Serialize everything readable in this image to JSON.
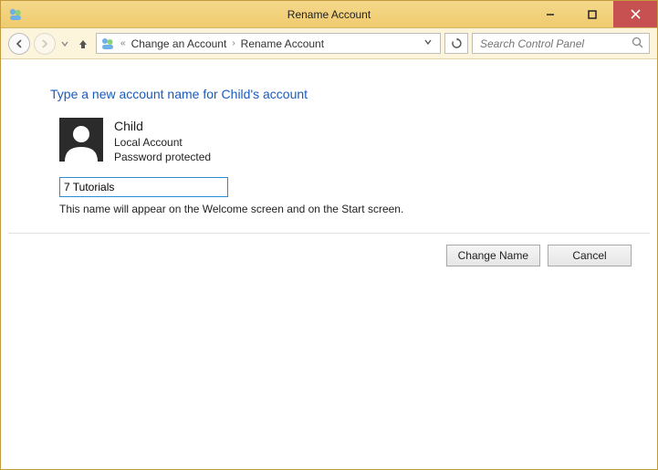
{
  "window": {
    "title": "Rename Account"
  },
  "breadcrumb": {
    "overflow": "«",
    "items": [
      "Change an Account",
      "Rename Account"
    ]
  },
  "search": {
    "placeholder": "Search Control Panel"
  },
  "page": {
    "heading": "Type a new account name for Child's account",
    "account": {
      "name": "Child",
      "type": "Local Account",
      "protection": "Password protected"
    },
    "input_value": "7 Tutorials",
    "helper": "This name will appear on the Welcome screen and on the Start screen."
  },
  "buttons": {
    "primary": "Change Name",
    "cancel": "Cancel"
  }
}
